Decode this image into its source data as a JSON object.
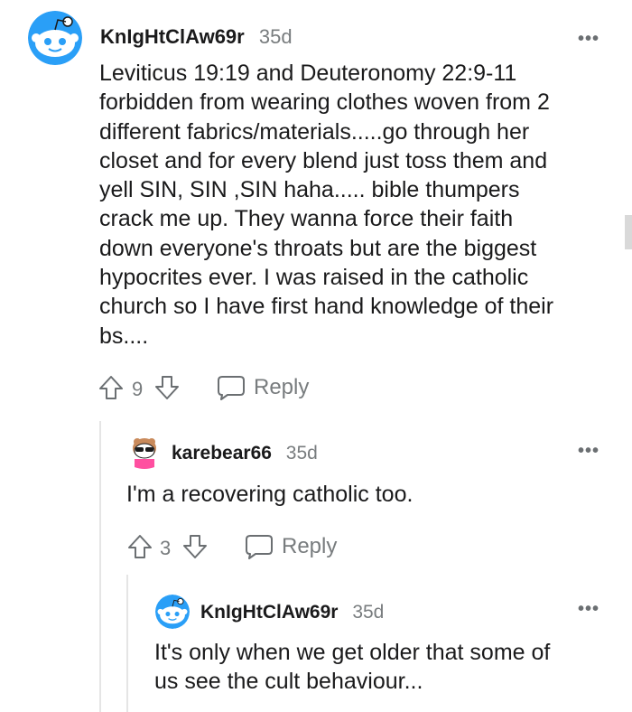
{
  "colors": {
    "text": "#1a1a1b",
    "meta": "#787c7e",
    "icon": "#6b6f72",
    "reddit_blue": "#2a9ff7",
    "thread_line": "#e5e5e5"
  },
  "comments": [
    {
      "username": "KnIgHtClAw69r",
      "age": "35d",
      "avatar": "snoo-blue-avatar",
      "body": [
        "Leviticus 19:19 and Deuteronomy 22:9-11",
        "forbidden from wearing clothes woven from 2",
        "different fabrics/materials.....go through her",
        "closet and for every blend just toss them and",
        "yell SIN, SIN ,SIN haha..... bible thumpers",
        "crack me up. They wanna force their faith",
        "down everyone's throats but are the biggest",
        "hypocrites ever. I was raised in the catholic",
        "church so I have first hand knowledge of their",
        "bs...."
      ],
      "votes": "9",
      "reply_label": "Reply"
    },
    {
      "username": "karebear66",
      "age": "35d",
      "avatar": "snoo-pink-sunglasses-avatar",
      "body": [
        "I'm a recovering catholic too."
      ],
      "votes": "3",
      "reply_label": "Reply"
    },
    {
      "username": "KnIgHtClAw69r",
      "age": "35d",
      "avatar": "snoo-blue-avatar",
      "body": [
        "It's only when we get older that some of",
        "us see the cult behaviour..."
      ]
    }
  ],
  "more_options_glyph": "•••"
}
